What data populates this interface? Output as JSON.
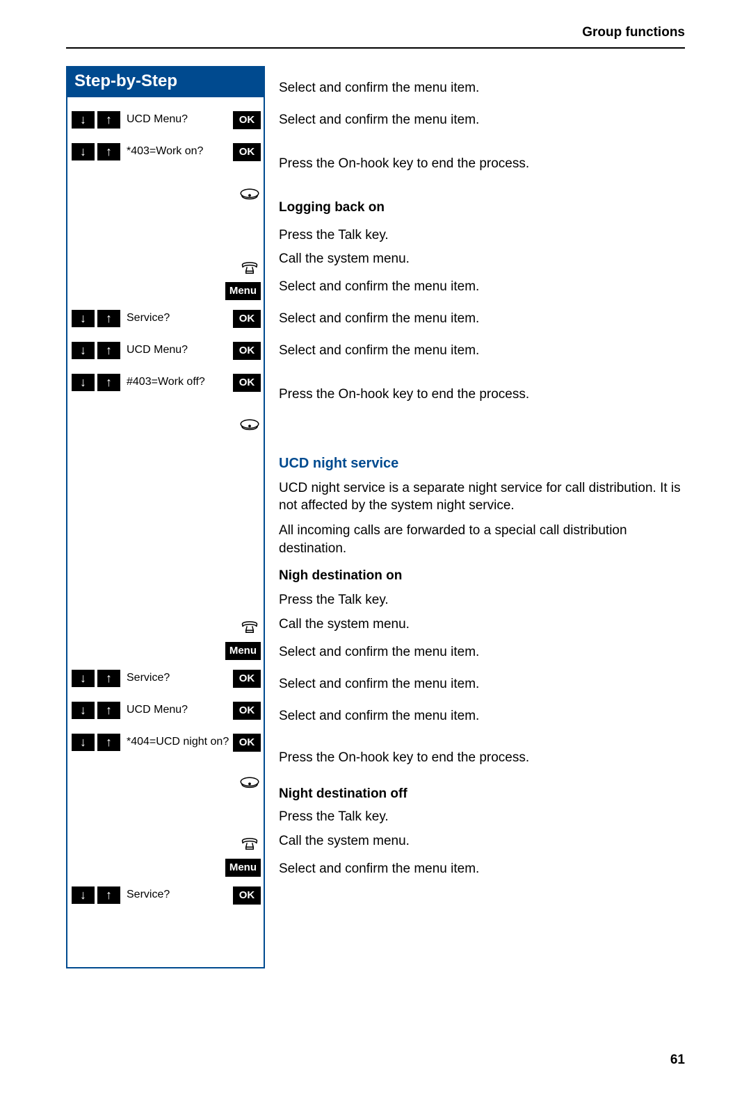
{
  "header": {
    "title": "Group functions"
  },
  "sidebar": {
    "title": "Step-by-Step"
  },
  "labels": {
    "ok": "OK",
    "menu": "Menu"
  },
  "display": {
    "ucd_menu": "UCD Menu?",
    "work_on": "*403=Work on?",
    "service": "Service?",
    "work_off": "#403=Work off?",
    "ucd_night_on": "*404=UCD night on?"
  },
  "text": {
    "select_confirm": "Select and confirm the menu item.",
    "press_onhook": "Press the On-hook key to end the process.",
    "logging_back": "Logging back on",
    "press_talk": "Press the Talk key.",
    "call_menu": "Call the system menu.",
    "ucd_night_heading": "UCD night service",
    "ucd_para1": "UCD night service is a separate night service for call distribution. It is not affected by the system night service.",
    "ucd_para2": "All incoming calls are forwarded to a special call distribution destination.",
    "night_on": "Nigh destination on",
    "night_off": "Night destination off"
  },
  "page_number": "61"
}
